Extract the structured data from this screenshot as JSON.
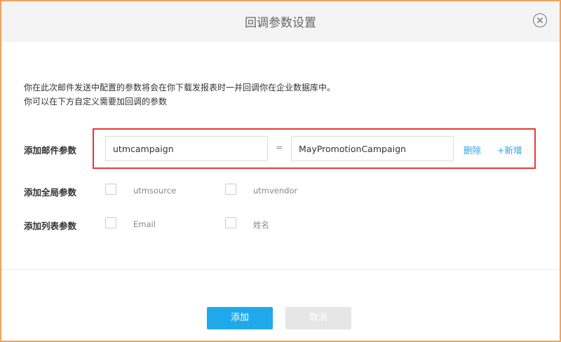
{
  "dialog": {
    "title": "回调参数设置",
    "close_icon": "close-circle-icon"
  },
  "description": {
    "line1": "你在此次邮件发送中配置的参数将会在你下载发报表时一并回调你在企业数据库中。",
    "line2": "你可以在下方自定义需要加回调的参数"
  },
  "mail_params": {
    "label": "添加邮件参数",
    "key_value": "utmcampaign",
    "equals": "=",
    "value_value": "MayPromotionCampaign",
    "delete_label": "删除",
    "add_label": "+新增",
    "highlight_color": "#e53935"
  },
  "global_params": {
    "label": "添加全局参数",
    "options": [
      {
        "label": "utmsource",
        "checked": false
      },
      {
        "label": "utmvendor",
        "checked": false
      }
    ]
  },
  "list_params": {
    "label": "添加列表参数",
    "options": [
      {
        "label": "Email",
        "checked": false
      },
      {
        "label": "姓名",
        "checked": false
      }
    ]
  },
  "footer": {
    "confirm_label": "添加",
    "cancel_label": "取消"
  },
  "colors": {
    "accent": "#1fa9eb",
    "link": "#2aa3e6",
    "border": "#f0a35c"
  }
}
